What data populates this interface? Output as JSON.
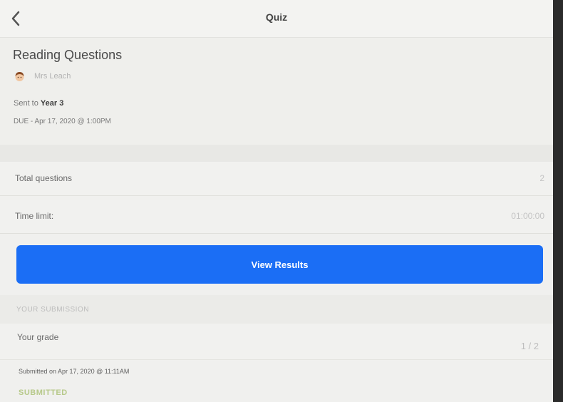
{
  "nav": {
    "title": "Quiz",
    "back_icon": "chevron-left-icon"
  },
  "quiz": {
    "title": "Reading Questions",
    "author": "Mrs Leach",
    "sent_to_label": "Sent to",
    "sent_to_value": "Year 3",
    "due": "DUE - Apr 17, 2020 @ 1:00PM"
  },
  "details": {
    "total_questions_label": "Total questions",
    "total_questions_value": "2",
    "time_limit_label": "Time limit:",
    "time_limit_value": "01:00:00"
  },
  "actions": {
    "view_results_label": "View Results"
  },
  "submission": {
    "section_header": "YOUR SUBMISSION",
    "grade_label": "Your grade",
    "grade_value": "1 / 2",
    "submitted_on": "Submitted on Apr 17, 2020 @ 11:11AM",
    "status": "SUBMITTED"
  },
  "colors": {
    "accent": "#1b6ef5",
    "status": "#b7c98a"
  }
}
